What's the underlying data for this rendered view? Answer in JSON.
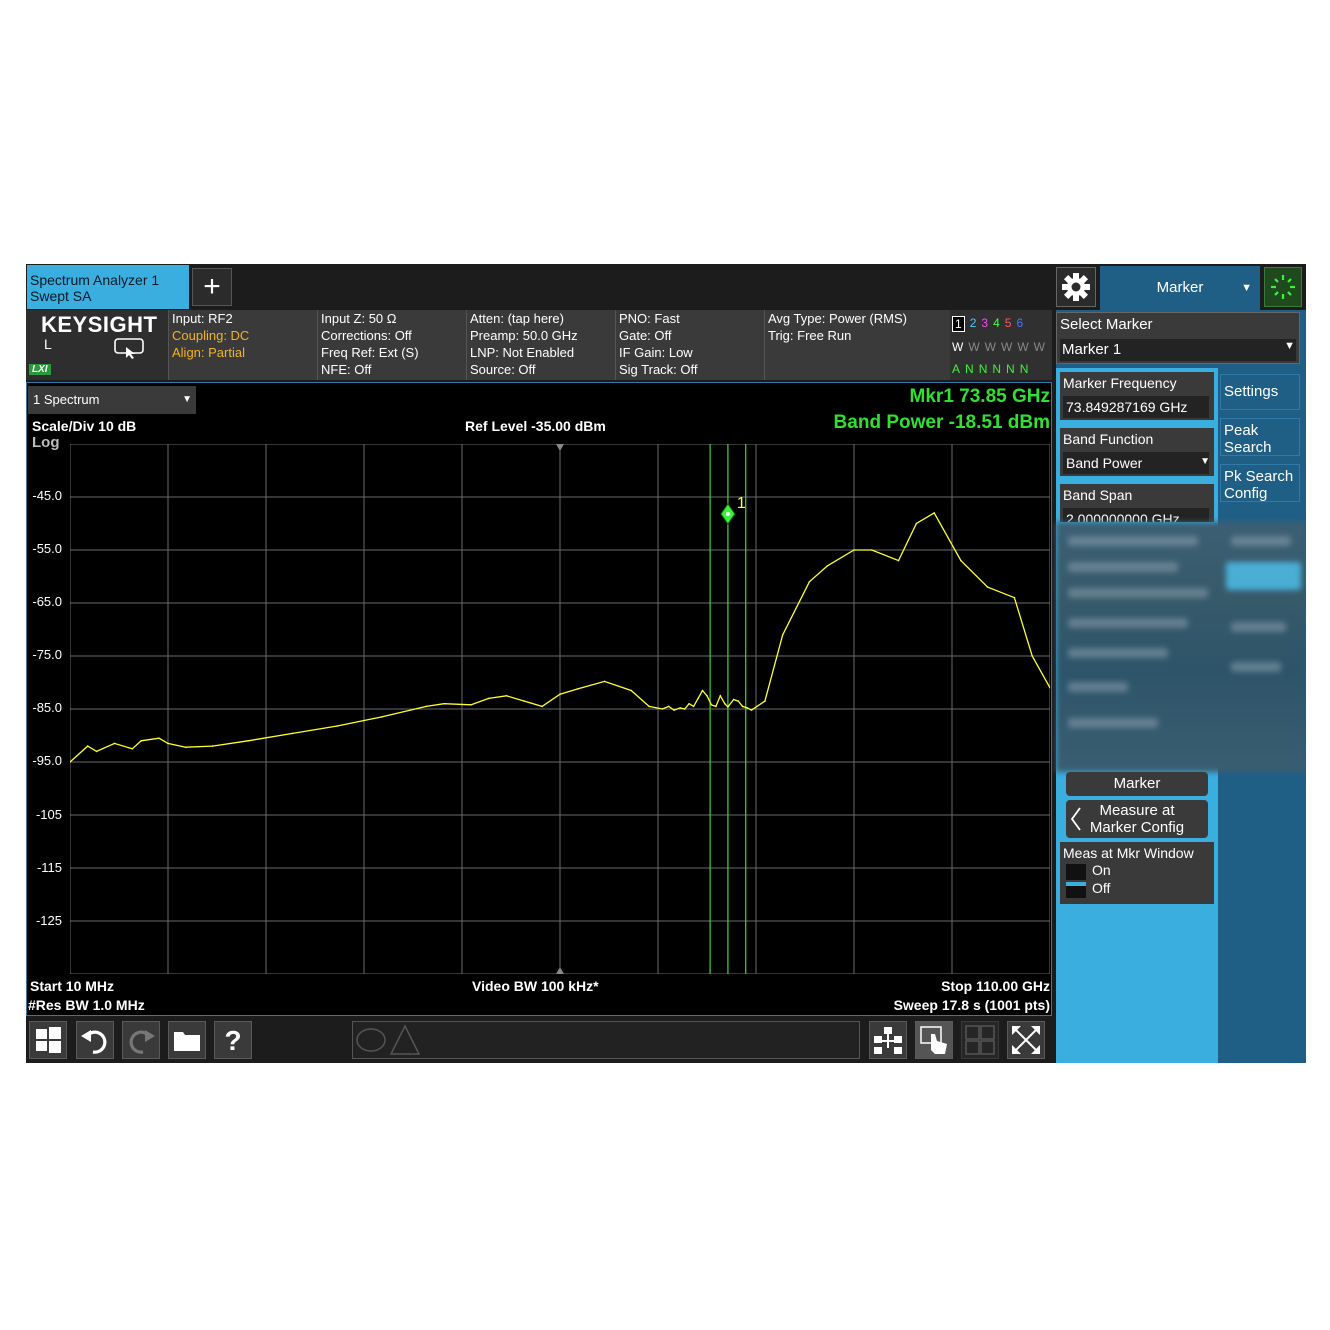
{
  "tabs": {
    "active_line1": "Spectrum Analyzer 1",
    "active_line2": "Swept SA",
    "add_label": "+"
  },
  "menu": {
    "title": "Marker"
  },
  "logo": {
    "brand": "KEYSIGHT",
    "mode": "L",
    "lxi": "LXI"
  },
  "info": {
    "col1": [
      "Input: RF2",
      "Coupling: DC",
      "Align: Partial"
    ],
    "col2": [
      "Input Z: 50 Ω",
      "Corrections: Off",
      "Freq Ref: Ext (S)",
      "NFE: Off"
    ],
    "col3": [
      "Atten: (tap here)",
      "Preamp: 50.0 GHz",
      "LNP: Not Enabled",
      "Source: Off"
    ],
    "col4": [
      "PNO: Fast",
      "Gate: Off",
      "IF Gain: Low",
      "Sig Track: Off"
    ],
    "col5": [
      "Avg Type: Power (RMS)",
      "Trig: Free Run"
    ]
  },
  "traces": {
    "numbers": [
      "1",
      "2",
      "3",
      "4",
      "5",
      "6"
    ],
    "colors": [
      "#ffff40",
      "#44ccff",
      "#ff44ff",
      "#44ff44",
      "#ff5555",
      "#4477ff"
    ],
    "types": [
      "W",
      "W",
      "W",
      "W",
      "W",
      "W"
    ],
    "dets": [
      "A",
      "N",
      "N",
      "N",
      "N",
      "N"
    ]
  },
  "window": {
    "selector": "1 Spectrum",
    "scale": "Scale/Div 10 dB",
    "log": "Log",
    "ref_level": "Ref Level -35.00 dBm",
    "mkr_readout": "Mkr1  73.85 GHz",
    "band_power": "Band Power  -18.51 dBm",
    "start": "Start 10 MHz",
    "res_bw": "#Res BW 1.0 MHz",
    "video_bw": "Video BW 100 kHz*",
    "stop": "Stop 110.00 GHz",
    "sweep": "Sweep 17.8 s (1001 pts)",
    "marker_label": "1"
  },
  "panel": {
    "select_marker_label": "Select Marker",
    "select_marker_value": "Marker 1",
    "marker_freq_label": "Marker Frequency",
    "marker_freq_value": "73.849287169 GHz",
    "band_function_label": "Band Function",
    "band_function_value": "Band Power",
    "band_span_label": "Band Span",
    "band_span_value": "2.000000000 GHz",
    "marker_btn": "Marker",
    "measure_at_l1": "Measure at",
    "measure_at_l2": "Marker Config",
    "meas_window_label": "Meas at Mkr Window",
    "opt_on": "On",
    "opt_off": "Off",
    "side_settings": "Settings",
    "side_peak_l1": "Peak",
    "side_peak_l2": "Search",
    "side_pk_l1": "Pk Search",
    "side_pk_l2": "Config"
  },
  "chart_data": {
    "type": "line",
    "title": "",
    "xlabel": "",
    "ylabel": "",
    "x_unit": "GHz",
    "y_unit": "dBm",
    "xlim": [
      0.01,
      110.0
    ],
    "ylim": [
      -135,
      -35
    ],
    "ytick_labels": [
      "-45.0",
      "-55.0",
      "-65.0",
      "-75.0",
      "-85.0",
      "-95.0",
      "-105",
      "-115",
      "-125"
    ],
    "ytick_values": [
      -45,
      -55,
      -65,
      -75,
      -85,
      -95,
      -105,
      -115,
      -125
    ],
    "grid": true,
    "series": [
      {
        "color": "#ffff30",
        "x": [
          0.01,
          2,
          3,
          5,
          7,
          8,
          10,
          11,
          13,
          16,
          20,
          25,
          30,
          35,
          40,
          42,
          45,
          47,
          49,
          51,
          53,
          55,
          57,
          60,
          63,
          65,
          66.5,
          67.2,
          67.8,
          68.5,
          69,
          69.5,
          70,
          70.5,
          71,
          71.5,
          72,
          72.5,
          73,
          73.5,
          73.85,
          74.5,
          75,
          75.5,
          76,
          76.5,
          78,
          80,
          83,
          85,
          88,
          90,
          93,
          95,
          97,
          100,
          103,
          106,
          108,
          110
        ],
        "y": [
          -95,
          -92,
          -93,
          -91.5,
          -92.5,
          -91,
          -90.5,
          -91.5,
          -92.2,
          -92,
          -91,
          -89.6,
          -88.2,
          -86.5,
          -84.5,
          -84,
          -84.2,
          -83,
          -82.5,
          -83.5,
          -84.5,
          -82.2,
          -81.2,
          -79.8,
          -81.5,
          -84.5,
          -85,
          -84.5,
          -85.2,
          -84.8,
          -85,
          -84,
          -84.5,
          -83,
          -81.5,
          -82.5,
          -84.2,
          -84.5,
          -82.5,
          -84,
          -84.6,
          -83.2,
          -83.5,
          -84.5,
          -84.8,
          -85.2,
          -83.5,
          -71,
          -61,
          -58,
          -55,
          -55,
          -57,
          -50,
          -48,
          -57,
          -62,
          -64,
          -75,
          -81
        ]
      }
    ],
    "marker": {
      "name": "1",
      "x": 73.85,
      "y": -48.2
    },
    "band_lines_x": [
      71.85,
      73.85,
      75.85
    ]
  }
}
